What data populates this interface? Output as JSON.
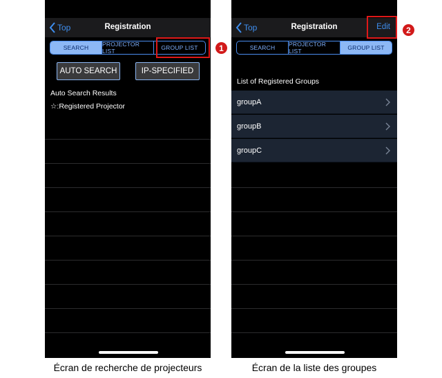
{
  "screen_search": {
    "nav": {
      "back_label": "Top",
      "title": "Registration"
    },
    "segments": [
      "SEARCH",
      "PROJECTOR LIST",
      "GROUP LIST"
    ],
    "active_segment": "SEARCH",
    "buttons": {
      "auto_search": "AUTO SEARCH",
      "ip_specified": "IP-SPECIFIED"
    },
    "results_title": "Auto Search Results",
    "legend": "☆:Registered Projector",
    "caption": "Écran de recherche de projecteurs"
  },
  "screen_groups": {
    "nav": {
      "back_label": "Top",
      "title": "Registration",
      "edit_label": "Edit"
    },
    "segments": [
      "SEARCH",
      "PROJECTOR LIST",
      "GROUP LIST"
    ],
    "active_segment": "GROUP LIST",
    "section_header": "List of Registered Groups",
    "groups": [
      "groupA",
      "groupB",
      "groupC"
    ],
    "caption": "Écran de la liste des groupes"
  },
  "annotations": {
    "marker_1": "1",
    "marker_2": "2",
    "color": "#e01818"
  },
  "colors": {
    "accent": "#3f8ff0",
    "segment_active": "#8db8f5",
    "group_row_bg": "#1c2533"
  },
  "icons": [
    "chevron-left-icon",
    "chevron-right-icon"
  ]
}
